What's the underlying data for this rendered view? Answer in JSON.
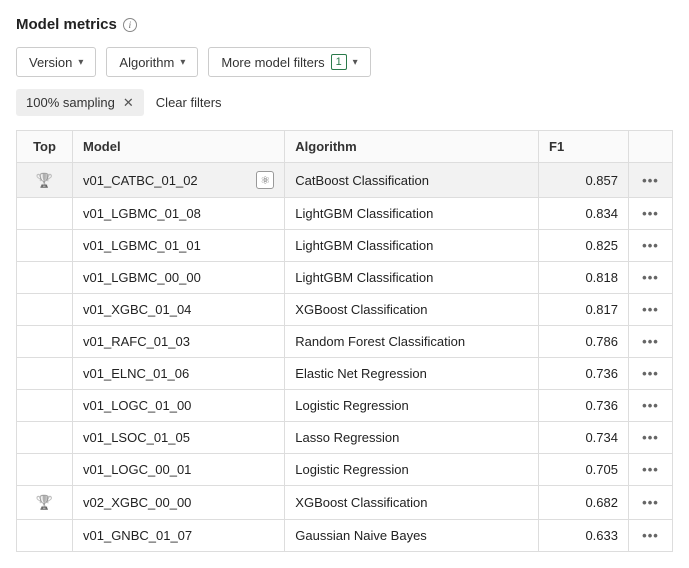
{
  "header": {
    "title": "Model metrics"
  },
  "filters": {
    "version": "Version",
    "algorithm": "Algorithm",
    "more": "More model filters",
    "more_count": "1"
  },
  "chips": {
    "sampling": "100% sampling",
    "clear": "Clear filters"
  },
  "table": {
    "columns": {
      "top": "Top",
      "model": "Model",
      "algorithm": "Algorithm",
      "f1": "F1"
    },
    "rows": [
      {
        "top": true,
        "model": "v01_CATBC_01_02",
        "algorithm": "CatBoost Classification",
        "f1": "0.857",
        "highlight": true,
        "atom": true
      },
      {
        "top": false,
        "model": "v01_LGBMC_01_08",
        "algorithm": "LightGBM Classification",
        "f1": "0.834",
        "highlight": false,
        "atom": false
      },
      {
        "top": false,
        "model": "v01_LGBMC_01_01",
        "algorithm": "LightGBM Classification",
        "f1": "0.825",
        "highlight": false,
        "atom": false
      },
      {
        "top": false,
        "model": "v01_LGBMC_00_00",
        "algorithm": "LightGBM Classification",
        "f1": "0.818",
        "highlight": false,
        "atom": false
      },
      {
        "top": false,
        "model": "v01_XGBC_01_04",
        "algorithm": "XGBoost Classification",
        "f1": "0.817",
        "highlight": false,
        "atom": false
      },
      {
        "top": false,
        "model": "v01_RAFC_01_03",
        "algorithm": "Random Forest Classification",
        "f1": "0.786",
        "highlight": false,
        "atom": false
      },
      {
        "top": false,
        "model": "v01_ELNC_01_06",
        "algorithm": "Elastic Net Regression",
        "f1": "0.736",
        "highlight": false,
        "atom": false
      },
      {
        "top": false,
        "model": "v01_LOGC_01_00",
        "algorithm": "Logistic Regression",
        "f1": "0.736",
        "highlight": false,
        "atom": false
      },
      {
        "top": false,
        "model": "v01_LSOC_01_05",
        "algorithm": "Lasso Regression",
        "f1": "0.734",
        "highlight": false,
        "atom": false
      },
      {
        "top": false,
        "model": "v01_LOGC_00_01",
        "algorithm": "Logistic Regression",
        "f1": "0.705",
        "highlight": false,
        "atom": false
      },
      {
        "top": true,
        "model": "v02_XGBC_00_00",
        "algorithm": "XGBoost Classification",
        "f1": "0.682",
        "highlight": false,
        "atom": false
      },
      {
        "top": false,
        "model": "v01_GNBC_01_07",
        "algorithm": "Gaussian Naive Bayes",
        "f1": "0.633",
        "highlight": false,
        "atom": false
      }
    ]
  }
}
